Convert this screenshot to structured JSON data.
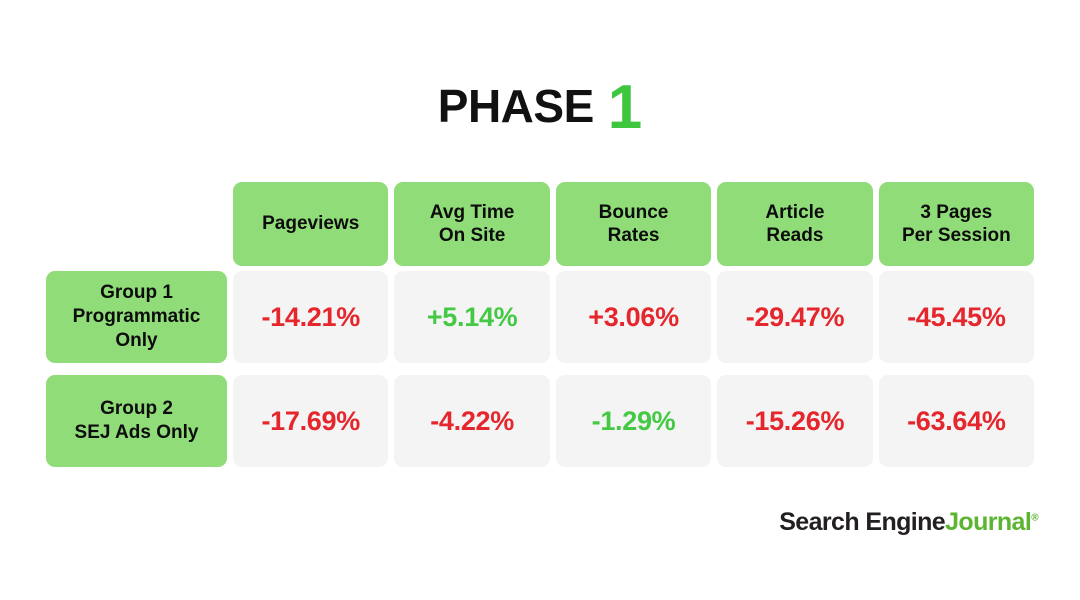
{
  "title": {
    "text": "PHASE",
    "number": "1",
    "number_color": "#3FC63F"
  },
  "colors": {
    "header_green": "#90DC79",
    "cell_background": "#F4F4F4",
    "negative_red": "#E5262C",
    "positive_green": "#44C944",
    "page_background": "#FFFFFF"
  },
  "table": {
    "corner_label": "",
    "columns": [
      {
        "label": "Pageviews"
      },
      {
        "label": "Avg Time\nOn Site",
        "line1": "Avg Time",
        "line2": "On Site"
      },
      {
        "label": "Bounce\nRates",
        "line1": "Bounce",
        "line2": "Rates"
      },
      {
        "label": "Article\nReads",
        "line1": "Article",
        "line2": "Reads"
      },
      {
        "label": "3 Pages\nPer Session",
        "line1": "3 Pages",
        "line2": "Per Session"
      }
    ],
    "rows": [
      {
        "label_line1": "Group 1",
        "label_line2": "Programmatic",
        "label_line3": "Only",
        "values": [
          {
            "text": "-14.21%",
            "sentiment": "negative"
          },
          {
            "text": "+5.14%",
            "sentiment": "positive"
          },
          {
            "text": "+3.06%",
            "sentiment": "negative"
          },
          {
            "text": "-29.47%",
            "sentiment": "negative"
          },
          {
            "text": "-45.45%",
            "sentiment": "negative"
          }
        ]
      },
      {
        "label_line1": "Group 2",
        "label_line2": "SEJ Ads Only",
        "label_line3": "",
        "values": [
          {
            "text": "-17.69%",
            "sentiment": "negative"
          },
          {
            "text": "-4.22%",
            "sentiment": "negative"
          },
          {
            "text": "-1.29%",
            "sentiment": "positive"
          },
          {
            "text": "-15.26%",
            "sentiment": "negative"
          },
          {
            "text": "-63.64%",
            "sentiment": "negative"
          }
        ]
      }
    ]
  },
  "logo": {
    "part1": "Search Engine",
    "part2": "Journal",
    "registered": "®"
  },
  "chart_data": {
    "type": "table",
    "title": "PHASE 1",
    "categories": [
      "Pageviews",
      "Avg Time On Site",
      "Bounce Rates",
      "Article Reads",
      "3 Pages Per Session"
    ],
    "series": [
      {
        "name": "Group 1 Programmatic Only",
        "values": [
          -14.21,
          5.14,
          3.06,
          -29.47,
          -45.45
        ],
        "labels": [
          "-14.21%",
          "+5.14%",
          "+3.06%",
          "-29.47%",
          "-45.45%"
        ],
        "label_colors": [
          "#E5262C",
          "#44C944",
          "#E5262C",
          "#E5262C",
          "#E5262C"
        ]
      },
      {
        "name": "Group 2 SEJ Ads Only",
        "values": [
          -17.69,
          -4.22,
          -1.29,
          -15.26,
          -63.64
        ],
        "labels": [
          "-17.69%",
          "-4.22%",
          "-1.29%",
          "-15.26%",
          "-63.64%"
        ],
        "label_colors": [
          "#E5262C",
          "#E5262C",
          "#44C944",
          "#E5262C",
          "#E5262C"
        ]
      }
    ],
    "units": "percent change",
    "xlabel": "",
    "ylabel": "",
    "grid": false,
    "legend": "row-labels"
  }
}
